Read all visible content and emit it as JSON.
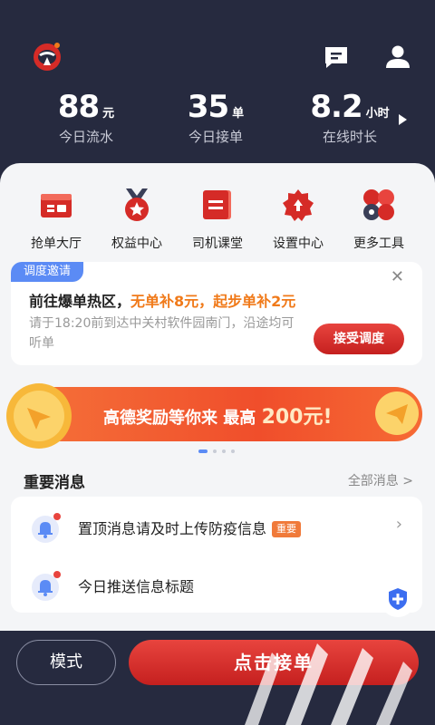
{
  "colors": {
    "header_bg": "#262a3f",
    "accent_red": "#d52b27",
    "accent_blue": "#5b8bf5",
    "orange": "#f07a1a"
  },
  "header": {
    "stats": [
      {
        "value": "88",
        "unit": "元",
        "label": "今日流水"
      },
      {
        "value": "35",
        "unit": "单",
        "label": "今日接单"
      },
      {
        "value": "8.2",
        "unit": "小时",
        "label": "在线时长"
      }
    ]
  },
  "tools": [
    {
      "label": "抢单大厅",
      "icon": "order-hall-icon"
    },
    {
      "label": "权益中心",
      "icon": "medal-icon"
    },
    {
      "label": "司机课堂",
      "icon": "classroom-icon"
    },
    {
      "label": "设置中心",
      "icon": "settings-icon"
    },
    {
      "label": "更多工具",
      "icon": "more-tools-icon"
    }
  ],
  "dispatch": {
    "tag": "调度邀请",
    "title_prefix": "前往爆单热区，",
    "title_highlight": "无单补8元，起步单补2元",
    "description": "请于18:20前到达中关村软件园南门，沿途均可听单",
    "accept_label": "接受调度"
  },
  "banner": {
    "text": "高德奖励等你来 最高",
    "amount": "200元!"
  },
  "messages": {
    "title": "重要消息",
    "all_label": "全部消息 >",
    "items": [
      {
        "text": "置顶消息请及时上传防疫信息",
        "badge": "重要"
      },
      {
        "text": "今日推送信息标题"
      }
    ]
  },
  "bottom": {
    "mode_label": "模式",
    "go_label": "点击接单"
  }
}
